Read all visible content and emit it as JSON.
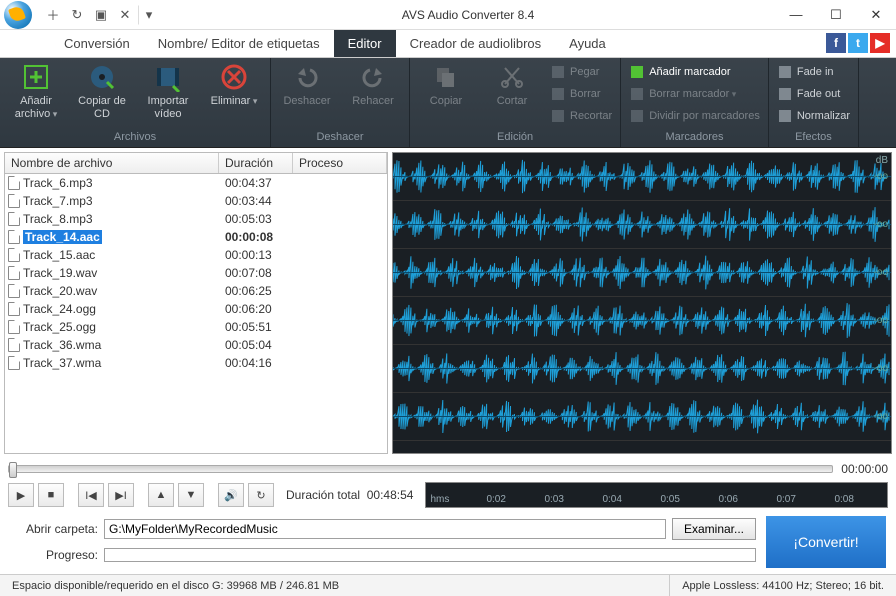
{
  "app_title": "AVS Audio Converter  8.4",
  "menus": [
    "Conversión",
    "Nombre/ Editor de etiquetas",
    "Editor",
    "Creador de audiolibros",
    "Ayuda"
  ],
  "active_menu": 2,
  "ribbon": {
    "groups": [
      {
        "label": "Archivos",
        "large": [
          {
            "name": "add-file",
            "label": "Añadir archivo",
            "arrow": true,
            "color": "#52c234"
          },
          {
            "name": "copy-cd",
            "label": "Copiar de CD",
            "color": "#2b7bbd"
          },
          {
            "name": "import-video",
            "label": "Importar vídeo",
            "color": "#2b7bbd"
          },
          {
            "name": "delete",
            "label": "Eliminar",
            "arrow": true,
            "color": "#d9443a"
          }
        ]
      },
      {
        "label": "Deshacer",
        "large": [
          {
            "name": "undo",
            "label": "Deshacer",
            "disabled": true
          },
          {
            "name": "redo",
            "label": "Rehacer",
            "disabled": true
          }
        ]
      },
      {
        "label": "Edición",
        "large": [
          {
            "name": "copy",
            "label": "Copiar",
            "disabled": true
          },
          {
            "name": "cut",
            "label": "Cortar",
            "disabled": true
          }
        ],
        "small": [
          {
            "name": "paste",
            "label": "Pegar",
            "disabled": true
          },
          {
            "name": "erase",
            "label": "Borrar",
            "disabled": true
          },
          {
            "name": "crop",
            "label": "Recortar",
            "disabled": true
          }
        ]
      },
      {
        "label": "Marcadores",
        "small": [
          {
            "name": "add-marker",
            "label": "Añadir marcador",
            "highlight": true
          },
          {
            "name": "delete-marker",
            "label": "Borrar marcador",
            "arrow": true,
            "disabled": true
          },
          {
            "name": "split-markers",
            "label": "Dividir por marcadores",
            "disabled": true
          }
        ]
      },
      {
        "label": "Efectos",
        "small": [
          {
            "name": "fade-in",
            "label": "Fade in"
          },
          {
            "name": "fade-out",
            "label": "Fade out"
          },
          {
            "name": "normalize",
            "label": "Normalizar"
          }
        ]
      }
    ]
  },
  "file_columns": {
    "name": "Nombre de archivo",
    "duration": "Duración",
    "process": "Proceso"
  },
  "files": [
    {
      "name": "Track_6.mp3",
      "dur": "00:04:37"
    },
    {
      "name": "Track_7.mp3",
      "dur": "00:03:44"
    },
    {
      "name": "Track_8.mp3",
      "dur": "00:05:03"
    },
    {
      "name": "Track_14.aac",
      "dur": "00:00:08",
      "selected": true
    },
    {
      "name": "Track_15.aac",
      "dur": "00:00:13"
    },
    {
      "name": "Track_19.wav",
      "dur": "00:07:08"
    },
    {
      "name": "Track_20.wav",
      "dur": "00:06:25"
    },
    {
      "name": "Track_24.ogg",
      "dur": "00:06:20"
    },
    {
      "name": "Track_25.ogg",
      "dur": "00:05:51"
    },
    {
      "name": "Track_36.wma",
      "dur": "00:05:04"
    },
    {
      "name": "Track_37.wma",
      "dur": "00:04:16"
    }
  ],
  "slider_time": "00:00:00",
  "total_label": "Duración total",
  "total_time": "00:48:54",
  "timeline": {
    "unit": "hms",
    "ticks": [
      "0:02",
      "0:03",
      "0:04",
      "0:05",
      "0:06",
      "0:07",
      "0:08"
    ]
  },
  "db_label": "dB",
  "wave_inf": "-oo",
  "open_folder_label": "Abrir carpeta:",
  "open_folder_value": "G:\\MyFolder\\MyRecordedMusic",
  "browse_label": "Examinar...",
  "progress_label": "Progreso:",
  "convert_label": "¡Convertir!",
  "status_disk": "Espacio disponible/requerido en el disco G: 39968 MB / 246.81 MB",
  "status_format": "Apple Lossless:  44100  Hz;  Stereo;  16 bit."
}
